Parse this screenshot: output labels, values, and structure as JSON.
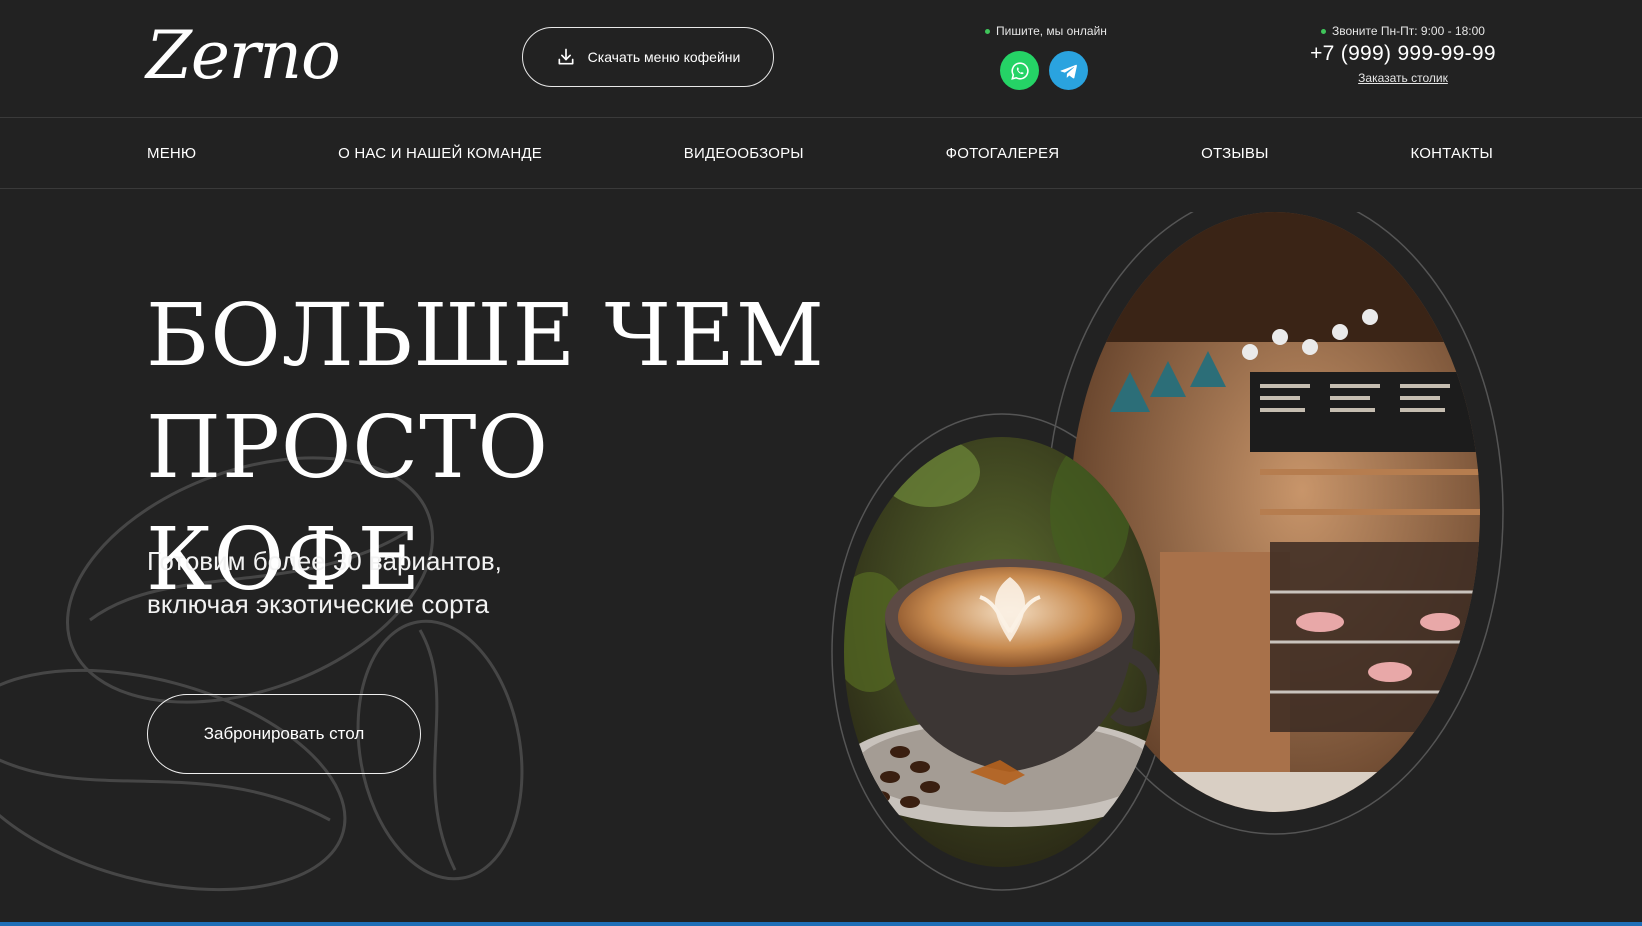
{
  "brand": {
    "logo_text": "Zerno"
  },
  "header": {
    "download_label": "Скачать меню кофейни",
    "online_text": "Пишите, мы онлайн",
    "hours_text": "Звоните Пн-Пт: 9:00 - 18:00",
    "phone": "+7 (999) 999-99-99",
    "reserve_link": "Заказать столик",
    "messengers": [
      "whatsapp-icon",
      "telegram-icon"
    ]
  },
  "nav": {
    "items": [
      {
        "label": "МЕНЮ"
      },
      {
        "label": "О НАС И НАШЕЙ КОМАНДЕ"
      },
      {
        "label": "ВИДЕООБЗОРЫ"
      },
      {
        "label": "ФОТОГАЛЕРЕЯ"
      },
      {
        "label": "ОТЗЫВЫ"
      },
      {
        "label": "КОНТАКТЫ"
      }
    ]
  },
  "hero": {
    "title_line1": "БОЛЬШЕ ЧЕМ",
    "title_line2": "ПРОСТО КОФЕ",
    "subtitle_line1": "Готовим более 30 вариантов,",
    "subtitle_line2": "включая экзотические сорта",
    "button_label": "Забронировать стол"
  },
  "colors": {
    "background": "#222222",
    "text": "#ffffff",
    "online_dot": "#3fc55a",
    "whatsapp": "#25d366",
    "telegram": "#2aa3df"
  }
}
